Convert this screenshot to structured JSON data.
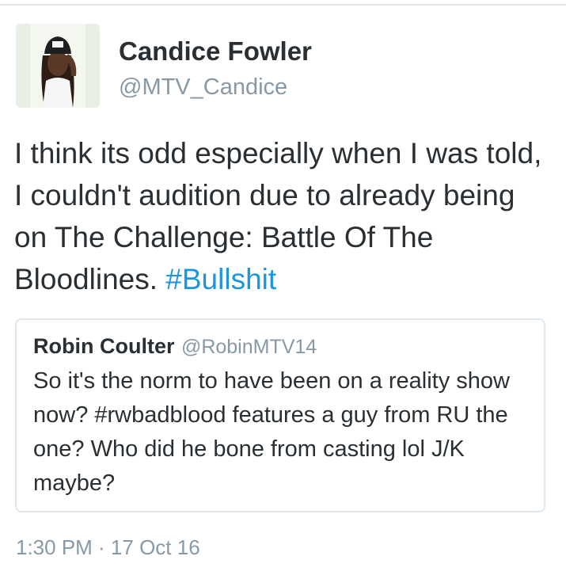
{
  "tweet": {
    "author": {
      "display_name": "Candice Fowler",
      "handle": "@MTV_Candice",
      "avatar": "profile-photo"
    },
    "text": "I think its odd especially when I was told, I couldn't audition due to already being on The Challenge: Battle Of The Bloodlines.",
    "hashtag": "#Bullshit",
    "timestamp": "1:30 PM · 17 Oct 16"
  },
  "quoted_tweet": {
    "author": {
      "display_name": "Robin Coulter",
      "handle": "@RobinMTV14"
    },
    "text": "So it's the norm to have been on a reality show now? #rwbadblood features a guy from RU the one? Who did he bone from casting lol J/K maybe?"
  },
  "colors": {
    "text": "#292f33",
    "secondary": "#8899a6",
    "link": "#1b95e0",
    "border": "#e1e8ed"
  }
}
